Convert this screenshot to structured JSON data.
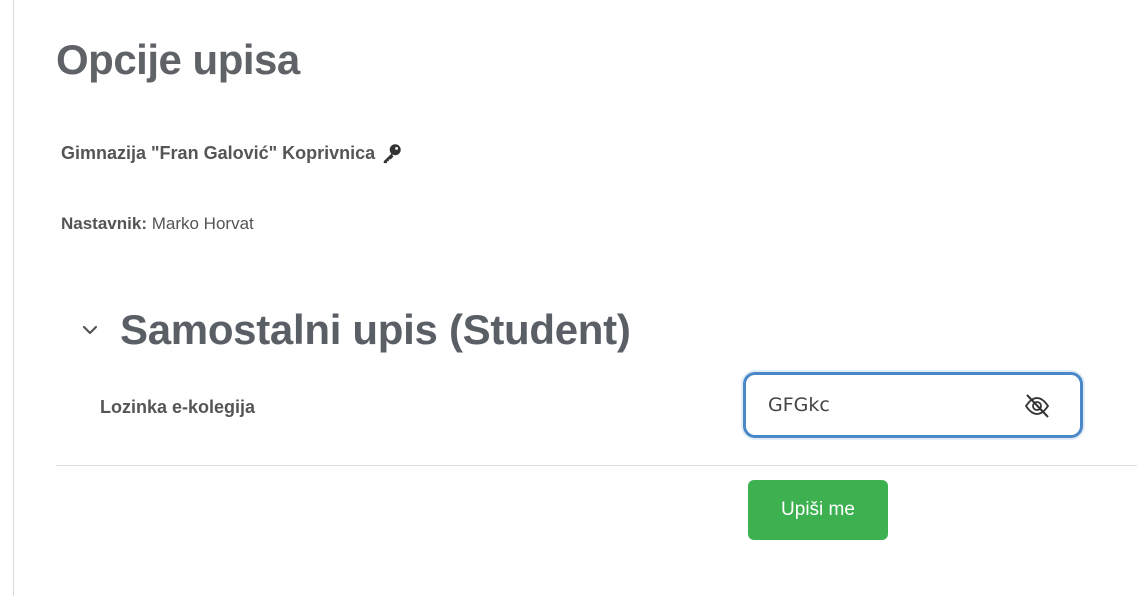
{
  "page": {
    "title": "Opcije upisa"
  },
  "course": {
    "name": "Gimnazija \"Fran Galović\" Koprivnica",
    "icon": "key-icon"
  },
  "teacher": {
    "label": "Nastavnik:",
    "name": "Marko Horvat"
  },
  "section": {
    "title": "Samostalni upis (Student)",
    "expanded": true,
    "icon": "chevron-down-icon"
  },
  "form": {
    "password_label": "Lozinka e-kolegija",
    "password_value": "GFGkc",
    "password_visible": true,
    "toggle_icon": "eye-slash-icon",
    "focus_color": "#4a88c7"
  },
  "actions": {
    "enrol_label": "Upiši me",
    "enrol_color": "#3db04f"
  }
}
